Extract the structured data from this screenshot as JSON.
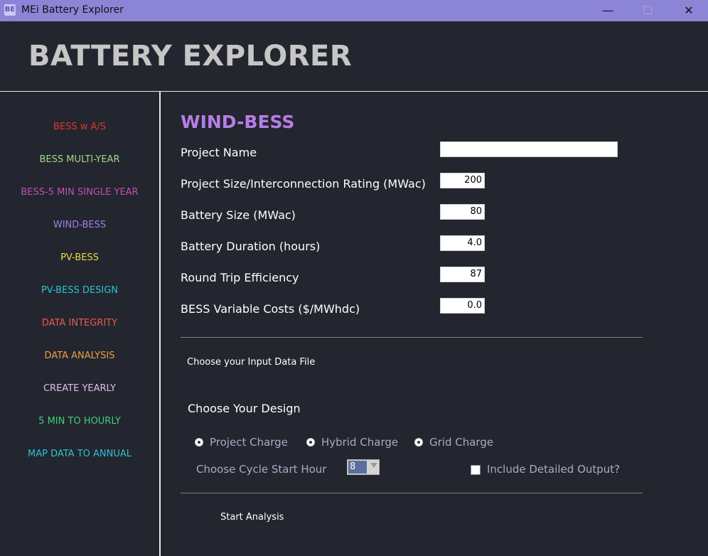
{
  "window": {
    "title": "MEi Battery Explorer",
    "icon_name": "app-logo-icon",
    "controls": {
      "minimize": "—",
      "maximize": "☐",
      "close": "✕"
    }
  },
  "header": {
    "title": "BATTERY EXPLORER"
  },
  "sidebar": {
    "items": [
      {
        "label": "BESS w A/S",
        "color": "#e0352e"
      },
      {
        "label": "BESS MULTI-YEAR",
        "color": "#9fd88a"
      },
      {
        "label": "BESS-5 MIN SINGLE YEAR",
        "color": "#c14fb5"
      },
      {
        "label": "WIND-BESS",
        "color": "#a57ee0"
      },
      {
        "label": "PV-BESS",
        "color": "#e6da45"
      },
      {
        "label": "PV-BESS DESIGN",
        "color": "#2cc1d0"
      },
      {
        "label": "DATA INTEGRITY",
        "color": "#e85a53"
      },
      {
        "label": "DATA ANALYSIS",
        "color": "#ef9c4a"
      },
      {
        "label": "CREATE YEARLY",
        "color": "#d9c3ea"
      },
      {
        "label": "5 MIN TO HOURLY",
        "color": "#3fcf7e"
      },
      {
        "label": "MAP DATA TO ANNUAL",
        "color": "#2cc1d0"
      }
    ]
  },
  "main": {
    "title": "WIND-BESS",
    "fields": [
      {
        "label": "Project Name",
        "value": ""
      },
      {
        "label": "Project Size/Interconnection Rating (MWac)",
        "value": "200"
      },
      {
        "label": "Battery Size (MWac)",
        "value": "80"
      },
      {
        "label": "Battery Duration (hours)",
        "value": "4.0"
      },
      {
        "label": "Round Trip Efficiency",
        "value": "87"
      },
      {
        "label": "BESS Variable Costs ($/MWhdc)",
        "value": "0.0"
      }
    ],
    "input_file_label": "Choose your Input Data File",
    "design_label": "Choose Your Design",
    "design_options": [
      {
        "label": "Project Charge",
        "checked": true
      },
      {
        "label": "Hybrid Charge",
        "checked": false
      },
      {
        "label": "Grid Charge",
        "checked": false
      }
    ],
    "cycle_label": "Choose Cycle Start Hour",
    "cycle_value": "8",
    "detailed_output_label": "Include Detailed Output?",
    "detailed_output_checked": false,
    "start_label": "Start Analysis"
  }
}
